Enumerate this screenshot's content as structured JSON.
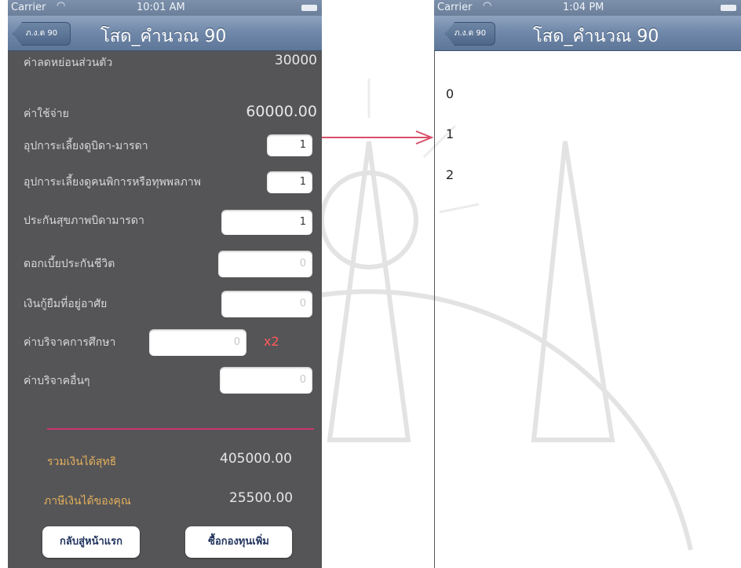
{
  "left_screen": {
    "status": {
      "carrier": "Carrier",
      "time": "10:01 AM"
    },
    "nav": {
      "back_label": "ภ.ง.ด 90",
      "title": "โสด_คำนวณ 90"
    },
    "rows": [
      {
        "label": "ค่าลดหย่อนส่วนตัว",
        "value": "30000"
      },
      {
        "label": "ค่าใช้จ่าย",
        "value": "60000.00"
      }
    ],
    "fields": [
      {
        "label": "อุปการะเลี้ยงดูบิดา-มารดา",
        "value": "1"
      },
      {
        "label": "อุปการะเลี้ยงดูคนพิการหรือทุพพลภาพ",
        "value": "1"
      },
      {
        "label": "ประกันสุขภาพบิดามารดา",
        "value": "1"
      },
      {
        "label": "ดอกเบี้ยประกันชีวิต",
        "value": "0"
      },
      {
        "label": "เงินกู้ยืมที่อยู่อาศัย",
        "value": "0"
      },
      {
        "label": "ค่าบริจาคการศึกษา",
        "value": "0",
        "multiplier": "x2"
      },
      {
        "label": "ค่าบริจาคอื่นๆ",
        "value": "0"
      }
    ],
    "summary": {
      "net_income_label": "รวมเงินได้สุทธิ",
      "net_income_value": "405000.00",
      "tax_label": "ภาษีเงินได้ของคุณ",
      "tax_value": "25500.00"
    },
    "buttons": {
      "home": "กลับสู่หน้าแรก",
      "buy_fund": "ซื้อกองทุนเพิ่ม"
    }
  },
  "right_screen": {
    "status": {
      "carrier": "Carrier",
      "time": "1:04 PM"
    },
    "nav": {
      "back_label": "ภ.ง.ด 90",
      "title": "โสด_คำนวณ 90"
    },
    "options": [
      "0",
      "1",
      "2"
    ]
  },
  "colors": {
    "content_bg": "#555558",
    "nav_bar": "#6f87a8",
    "divider": "#c9366b",
    "summary_label": "#e3b05a",
    "multiplier": "#ff5a5a",
    "arrow": "#d9506a"
  }
}
